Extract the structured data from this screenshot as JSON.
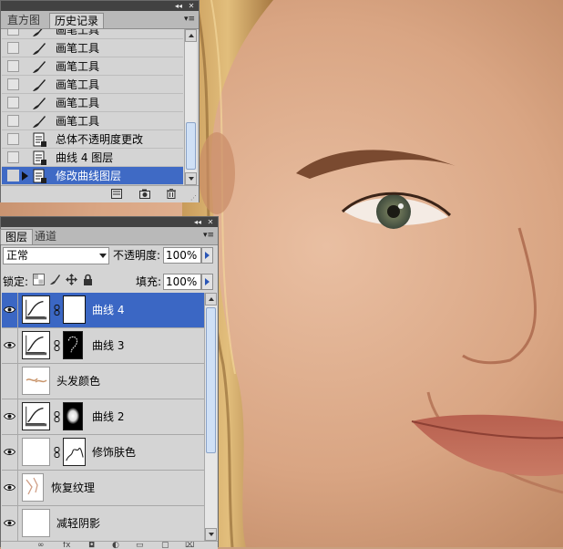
{
  "history_panel": {
    "tabs": [
      "直方图",
      "历史记录"
    ],
    "items": [
      {
        "label": "画笔工具",
        "icon": "brush-icon",
        "selected": false
      },
      {
        "label": "画笔工具",
        "icon": "brush-icon",
        "selected": false
      },
      {
        "label": "画笔工具",
        "icon": "brush-icon",
        "selected": false
      },
      {
        "label": "画笔工具",
        "icon": "brush-icon",
        "selected": false
      },
      {
        "label": "画笔工具",
        "icon": "brush-icon",
        "selected": false
      },
      {
        "label": "画笔工具",
        "icon": "brush-icon",
        "selected": false
      },
      {
        "label": "总体不透明度更改",
        "icon": "document-icon",
        "selected": false
      },
      {
        "label": "曲线 4 图层",
        "icon": "document-icon",
        "selected": false
      },
      {
        "label": "修改曲线图层",
        "icon": "document-icon",
        "selected": true
      }
    ],
    "footer_icons": [
      "new-document-from-state-icon",
      "new-snapshot-icon",
      "trash-icon"
    ]
  },
  "layers_panel": {
    "tabs": [
      "图层",
      "通道"
    ],
    "blend_mode": "正常",
    "opacity_label": "不透明度:",
    "opacity_value": "100%",
    "lock_label": "锁定:",
    "fill_label": "填充:",
    "fill_value": "100%",
    "layers": [
      {
        "name": "曲线 4",
        "kind": "curves",
        "mask": "white",
        "selected": true
      },
      {
        "name": "曲线 3",
        "kind": "curves",
        "mask": "ring",
        "selected": false
      },
      {
        "name": "头发颜色",
        "kind": "pixel",
        "mask": null,
        "selected": false
      },
      {
        "name": "曲线 2",
        "kind": "curves",
        "mask": "blob",
        "selected": false
      },
      {
        "name": "修饰肤色",
        "kind": "pixel",
        "mask": "stroke",
        "selected": false
      },
      {
        "name": "恢复纹理",
        "kind": "pixel",
        "mask": null,
        "selected": false
      },
      {
        "name": "减轻阴影",
        "kind": "pixel",
        "mask": null,
        "selected": false
      }
    ]
  },
  "colors": {
    "selection": "#3b67c4",
    "panel_bg": "#d4d4d4",
    "titlebar": "#424242"
  }
}
